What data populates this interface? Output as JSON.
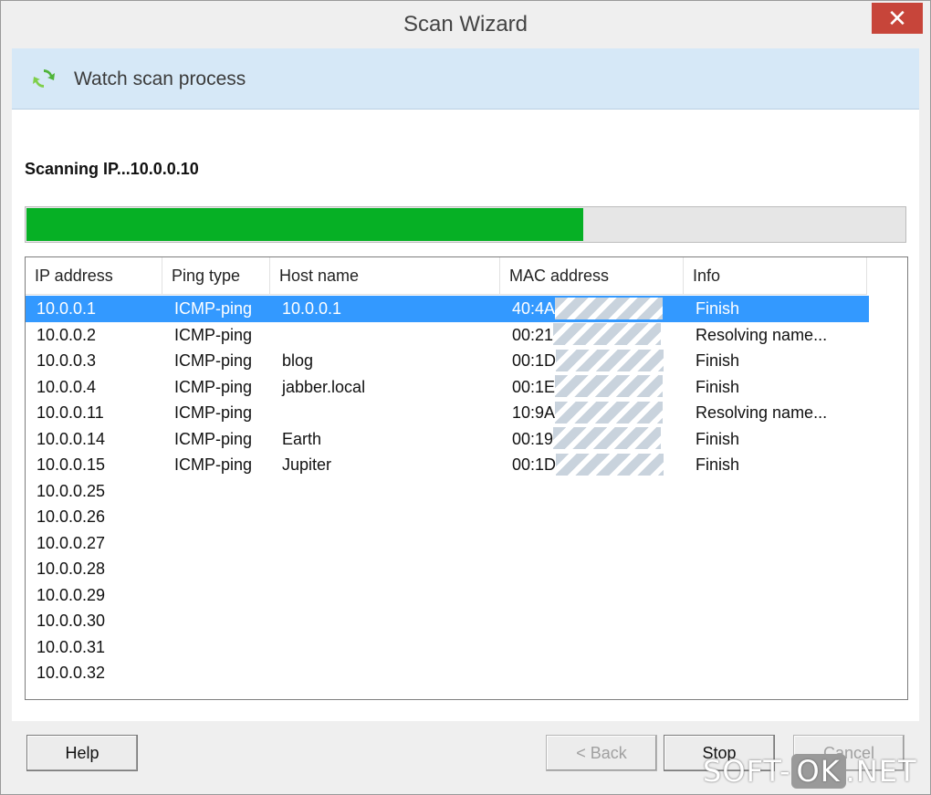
{
  "window": {
    "title": "Scan Wizard",
    "close_glyph": "✕"
  },
  "header": {
    "icon": "refresh-icon",
    "text": "Watch scan process"
  },
  "status": {
    "scanning_label": "Scanning IP...10.0.0.10",
    "progress_percent": 63.5
  },
  "table": {
    "columns": [
      "IP address",
      "Ping type",
      "Host name",
      "MAC address",
      "Info"
    ],
    "rows": [
      {
        "ip": "10.0.0.1",
        "ping": "ICMP-ping",
        "host": "10.0.0.1",
        "mac": "40:4A",
        "info": "Finish",
        "selected": true
      },
      {
        "ip": "10.0.0.2",
        "ping": "ICMP-ping",
        "host": "",
        "mac": "00:21",
        "info": "Resolving name..."
      },
      {
        "ip": "10.0.0.3",
        "ping": "ICMP-ping",
        "host": "blog",
        "mac": "00:1D",
        "info": "Finish"
      },
      {
        "ip": "10.0.0.4",
        "ping": "ICMP-ping",
        "host": "jabber.local",
        "mac": "00:1E",
        "info": "Finish"
      },
      {
        "ip": "10.0.0.11",
        "ping": "ICMP-ping",
        "host": "",
        "mac": "10:9A",
        "info": "Resolving name..."
      },
      {
        "ip": "10.0.0.14",
        "ping": "ICMP-ping",
        "host": "Earth",
        "mac": "00:19",
        "info": "Finish"
      },
      {
        "ip": "10.0.0.15",
        "ping": "ICMP-ping",
        "host": "Jupiter",
        "mac": "00:1D",
        "info": "Finish"
      },
      {
        "ip": "10.0.0.25",
        "ping": "",
        "host": "",
        "mac": "",
        "info": ""
      },
      {
        "ip": "10.0.0.26",
        "ping": "",
        "host": "",
        "mac": "",
        "info": ""
      },
      {
        "ip": "10.0.0.27",
        "ping": "",
        "host": "",
        "mac": "",
        "info": ""
      },
      {
        "ip": "10.0.0.28",
        "ping": "",
        "host": "",
        "mac": "",
        "info": ""
      },
      {
        "ip": "10.0.0.29",
        "ping": "",
        "host": "",
        "mac": "",
        "info": ""
      },
      {
        "ip": "10.0.0.30",
        "ping": "",
        "host": "",
        "mac": "",
        "info": ""
      },
      {
        "ip": "10.0.0.31",
        "ping": "",
        "host": "",
        "mac": "",
        "info": ""
      },
      {
        "ip": "10.0.0.32",
        "ping": "",
        "host": "",
        "mac": "",
        "info": ""
      }
    ]
  },
  "buttons": {
    "help": "Help",
    "back": "< Back",
    "stop": "Stop",
    "cancel": "Cancel"
  },
  "watermark": {
    "left": "SOFT-",
    "box": "OK",
    "right": ".NET"
  },
  "colors": {
    "progress": "#06b025",
    "selection": "#3399ff",
    "header_bg": "#d6e8f7",
    "close": "#c7453a"
  }
}
